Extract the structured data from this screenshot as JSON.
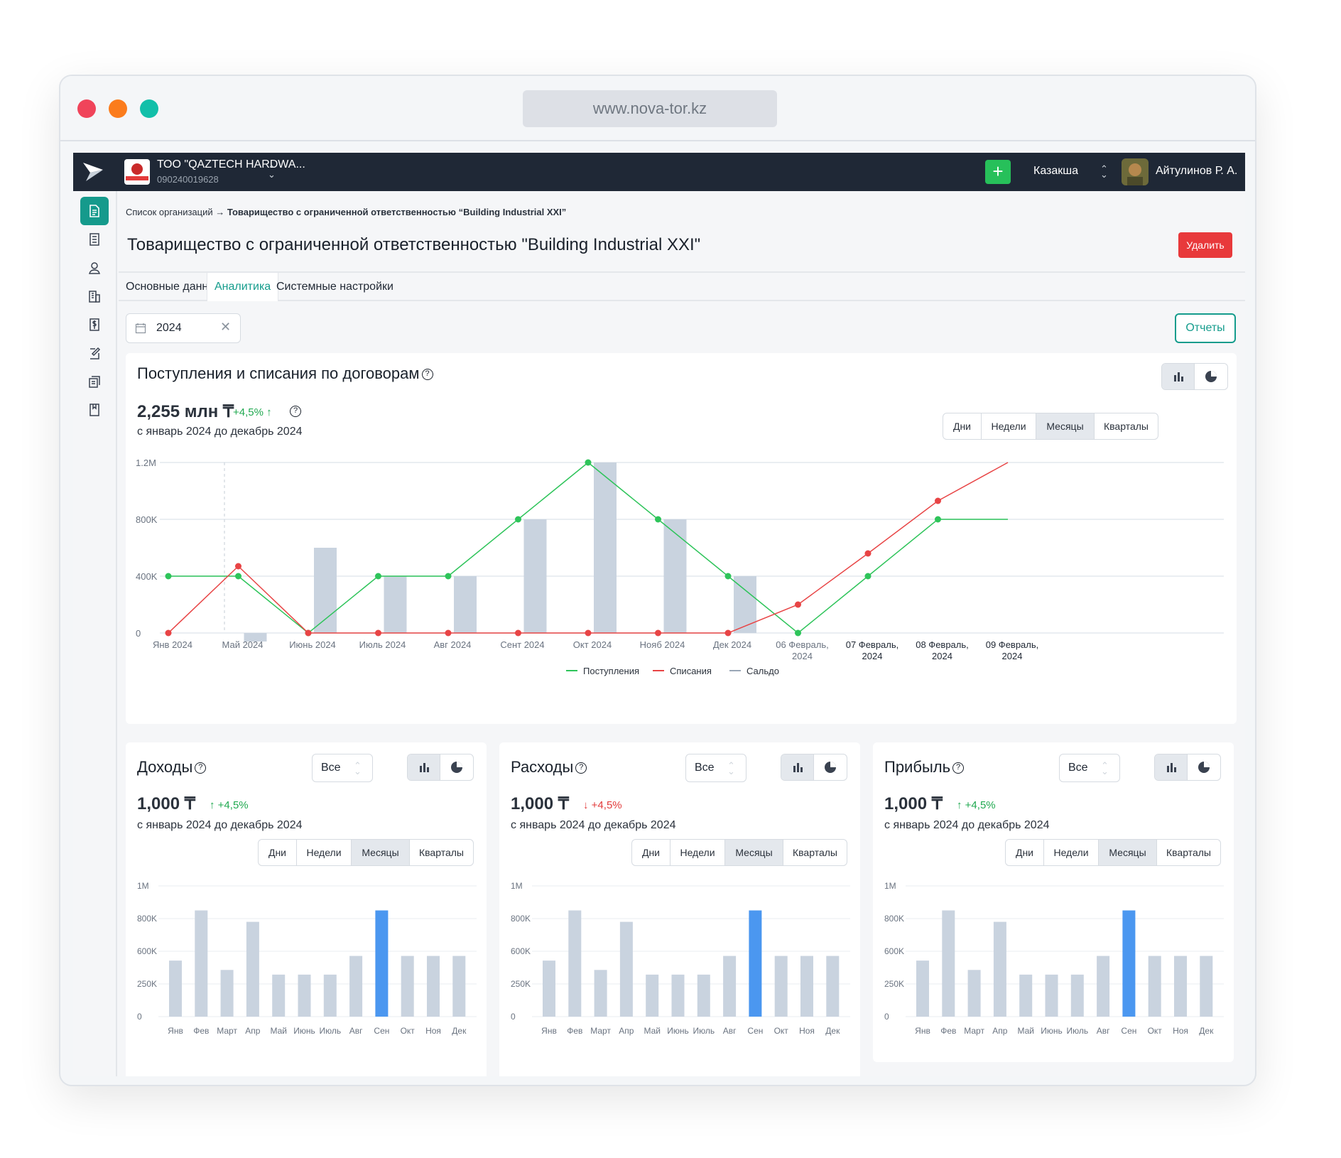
{
  "browser": {
    "url": "www.nova-tor.kz"
  },
  "topnav": {
    "org_name": "ТОО \"QAZTECH HARDWA...",
    "org_id": "090240019628",
    "language": "Казакша",
    "user": "Айтулинов Р. А.",
    "add_label": "+"
  },
  "breadcrumb": {
    "root": "Список организаций →",
    "current": "Товарищество с ограниченной ответственностью “Building Industrial XXI”"
  },
  "page": {
    "title": "Товарищество с ограниченной ответственностью \"Building Industrial XXI\"",
    "delete_label": "Удалить"
  },
  "tabs": [
    "Основные данные",
    "Аналитика",
    "Системные настройки"
  ],
  "filter": {
    "year": "2024",
    "reports_label": "Отчеты"
  },
  "colors": {
    "accent": "#149c8c",
    "income": "#2ec45a",
    "expense": "#e84445",
    "balance": "#c9d3df",
    "highlight": "#4b97f0",
    "delete": "#e8393b"
  },
  "main_chart": {
    "title": "Поступления и списания по договорам",
    "total": "2,255 млн ₸",
    "delta": "+4,5%",
    "period": "с январь 2024 до декабрь 2024",
    "granularity": [
      "Дни",
      "Недели",
      "Месяцы",
      "Кварталы"
    ],
    "selected_granularity": "Месяцы"
  },
  "small_cards": [
    {
      "title": "Доходы",
      "filter": "Все",
      "total": "1,000 ₸",
      "delta": "+4,5%",
      "direction": "up",
      "period": "с январь 2024 до декабрь 2024"
    },
    {
      "title": "Расходы",
      "filter": "Все",
      "total": "1,000 ₸",
      "delta": "+4,5%",
      "direction": "down",
      "period": "с январь 2024 до декабрь 2024"
    },
    {
      "title": "Прибыль",
      "filter": "Все",
      "total": "1,000 ₸",
      "delta": "+4,5%",
      "direction": "up",
      "period": "с январь 2024 до декабрь 2024"
    }
  ],
  "granularity": [
    "Дни",
    "Недели",
    "Месяцы",
    "Кварталы"
  ],
  "chart_data": [
    {
      "type": "line",
      "x": [
        "Янв 2024",
        "Май 2024",
        "Июнь 2024",
        "Июль 2024",
        "Авг 2024",
        "Сент 2024",
        "Окт 2024",
        "Нояб 2024",
        "Дек 2024",
        "06 Февраль, 2024",
        "07 Февраль, 2024",
        "08 Февраль, 2024",
        "09 Февраль, 2024"
      ],
      "yticks": [
        "0",
        "400K",
        "800K",
        "1.2M"
      ],
      "ylim": [
        0,
        1200000
      ],
      "series": [
        {
          "name": "Поступления",
          "kind": "line",
          "values": [
            400000,
            400000,
            0,
            400000,
            400000,
            800000,
            1200000,
            800000,
            400000,
            0,
            400000,
            800000,
            800000
          ]
        },
        {
          "name": "Списания",
          "kind": "line",
          "values": [
            0,
            470000,
            0,
            0,
            0,
            0,
            0,
            0,
            0,
            200000,
            560000,
            930000,
            1200000
          ]
        },
        {
          "name": "Сальдо",
          "kind": "bar",
          "values": [
            null,
            -60000,
            600000,
            400000,
            400000,
            800000,
            1200000,
            800000,
            400000,
            null,
            null,
            null,
            null
          ]
        }
      ],
      "legend": "bottom-center"
    },
    {
      "type": "bar",
      "categories": [
        "Янв",
        "Фев",
        "Март",
        "Апр",
        "Май",
        "Июнь",
        "Июль",
        "Авг",
        "Сен",
        "Окт",
        "Ноя",
        "Дек"
      ],
      "yticks": [
        "0",
        "250K",
        "600K",
        "800K",
        "1M"
      ],
      "values": [
        500000,
        850000,
        400000,
        780000,
        350000,
        350000,
        350000,
        550000,
        850000,
        550000,
        550000,
        550000
      ],
      "highlight_index": 8
    }
  ]
}
